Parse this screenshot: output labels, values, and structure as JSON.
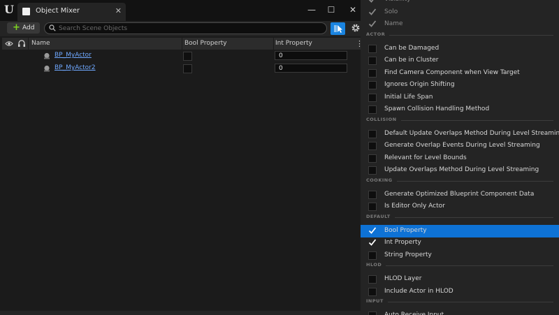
{
  "window": {
    "tab_title": "Object Mixer",
    "close_glyph": "✕",
    "minimize_glyph": "—",
    "maximize_glyph": "☐",
    "window_close_glyph": "✕"
  },
  "toolbar": {
    "add_label": "Add",
    "search_placeholder": "Search Scene Objects"
  },
  "table": {
    "columns": {
      "name": "Name",
      "bool": "Bool Property",
      "int": "Int Property"
    },
    "rows": [
      {
        "name": "BP_MyActor",
        "bool": false,
        "int": "0"
      },
      {
        "name": "BP_MyActor2",
        "bool": false,
        "int": "0"
      }
    ]
  },
  "menu": {
    "top_items": [
      {
        "label": "Visibility",
        "checked": true
      },
      {
        "label": "Solo",
        "checked": true
      },
      {
        "label": "Name",
        "checked": true
      }
    ],
    "sections": [
      {
        "title": "ACTOR",
        "items": [
          {
            "label": "Can be Damaged",
            "checked": false
          },
          {
            "label": "Can be in Cluster",
            "checked": false
          },
          {
            "label": "Find Camera Component when View Target",
            "checked": false
          },
          {
            "label": "Ignores Origin Shifting",
            "checked": false
          },
          {
            "label": "Initial Life Span",
            "checked": false
          },
          {
            "label": "Spawn Collision Handling Method",
            "checked": false
          }
        ]
      },
      {
        "title": "COLLISION",
        "items": [
          {
            "label": "Default Update Overlaps Method During Level Streaming",
            "checked": false
          },
          {
            "label": "Generate Overlap Events During Level Streaming",
            "checked": false
          },
          {
            "label": "Relevant for Level Bounds",
            "checked": false
          },
          {
            "label": "Update Overlaps Method During Level Streaming",
            "checked": false
          }
        ]
      },
      {
        "title": "COOKING",
        "items": [
          {
            "label": "Generate Optimized Blueprint Component Data",
            "checked": false
          },
          {
            "label": "Is Editor Only Actor",
            "checked": false
          }
        ]
      },
      {
        "title": "DEFAULT",
        "items": [
          {
            "label": "Bool Property",
            "checked": true,
            "selected": true
          },
          {
            "label": "Int Property",
            "checked": true
          },
          {
            "label": "String Property",
            "checked": false
          }
        ]
      },
      {
        "title": "HLOD",
        "items": [
          {
            "label": "HLOD Layer",
            "checked": false
          },
          {
            "label": "Include Actor in HLOD",
            "checked": false
          }
        ]
      },
      {
        "title": "INPUT",
        "items": [
          {
            "label": "Auto Receive Input",
            "checked": false
          }
        ]
      }
    ]
  },
  "colors": {
    "accent": "#0e72d5",
    "link": "#6fa8ff",
    "add_plus": "#7ed321"
  }
}
